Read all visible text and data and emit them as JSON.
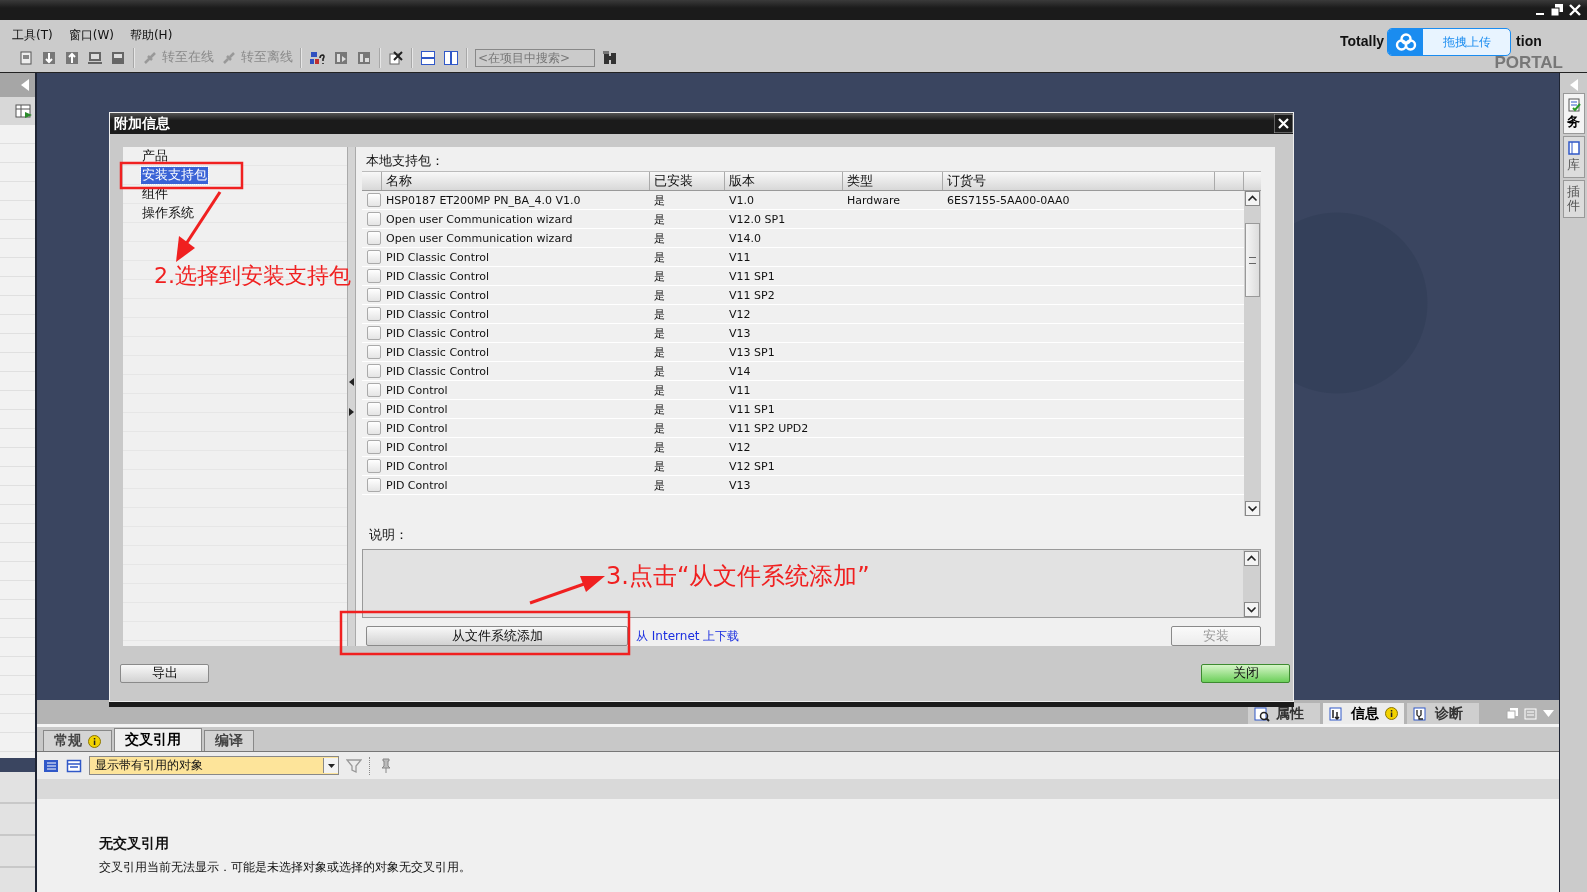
{
  "menu": [
    {
      "label": "工具(T)"
    },
    {
      "label": "窗口(W)"
    },
    {
      "label": "帮助(H)"
    }
  ],
  "toolbar": {
    "go_online": "转至在线",
    "go_offline": "转至离线",
    "search": {
      "placeholder": "<在项目中搜索>"
    }
  },
  "brand": {
    "line1_start": "Totally",
    "line1_end": "tion",
    "line2": "PORTAL"
  },
  "upload_widget": {
    "label": "拖拽上传"
  },
  "right_tabs": [
    {
      "label": "务",
      "selected": true
    },
    {
      "label": "库",
      "selected": false
    },
    {
      "label": "插件",
      "selected": false
    }
  ],
  "dialog": {
    "title": "附加信息",
    "nav": [
      {
        "label": "产品",
        "selected": false
      },
      {
        "label": "安装支持包",
        "selected": true
      },
      {
        "label": "组件",
        "selected": false
      },
      {
        "label": "操作系统",
        "selected": false
      }
    ],
    "section_label": "本地支持包：",
    "table": {
      "columns": [
        "名称",
        "已安装",
        "版本",
        "类型",
        "订货号"
      ],
      "rows": [
        {
          "checked": false,
          "cells": [
            "HSP0187 ET200MP PN_BA_4.0 V1.0",
            "是",
            "V1.0",
            "Hardware",
            "6ES7155-5AA00-0AA0"
          ]
        },
        {
          "checked": false,
          "cells": [
            "Open user Communication wizard",
            "是",
            "V12.0 SP1",
            "",
            ""
          ]
        },
        {
          "checked": false,
          "cells": [
            "Open user Communication wizard",
            "是",
            "V14.0",
            "",
            ""
          ]
        },
        {
          "checked": false,
          "cells": [
            "PID Classic Control",
            "是",
            "V11",
            "",
            ""
          ]
        },
        {
          "checked": false,
          "cells": [
            "PID Classic Control",
            "是",
            "V11 SP1",
            "",
            ""
          ]
        },
        {
          "checked": false,
          "cells": [
            "PID Classic Control",
            "是",
            "V11 SP2",
            "",
            ""
          ]
        },
        {
          "checked": false,
          "cells": [
            "PID Classic Control",
            "是",
            "V12",
            "",
            ""
          ]
        },
        {
          "checked": false,
          "cells": [
            "PID Classic Control",
            "是",
            "V13",
            "",
            ""
          ]
        },
        {
          "checked": false,
          "cells": [
            "PID Classic Control",
            "是",
            "V13 SP1",
            "",
            ""
          ]
        },
        {
          "checked": false,
          "cells": [
            "PID Classic Control",
            "是",
            "V14",
            "",
            ""
          ]
        },
        {
          "checked": false,
          "cells": [
            "PID Control",
            "是",
            "V11",
            "",
            ""
          ]
        },
        {
          "checked": false,
          "cells": [
            "PID Control",
            "是",
            "V11 SP1",
            "",
            ""
          ]
        },
        {
          "checked": false,
          "cells": [
            "PID Control",
            "是",
            "V11 SP2 UPD2",
            "",
            ""
          ]
        },
        {
          "checked": false,
          "cells": [
            "PID Control",
            "是",
            "V12",
            "",
            ""
          ]
        },
        {
          "checked": false,
          "cells": [
            "PID Control",
            "是",
            "V12 SP1",
            "",
            ""
          ]
        },
        {
          "checked": false,
          "cells": [
            "PID Control",
            "是",
            "V13",
            "",
            ""
          ]
        }
      ]
    },
    "description_label": "说明：",
    "add_button": "从文件系统添加",
    "download_link": "从 Internet 上下载",
    "install_button": {
      "label": "安装",
      "disabled": true
    },
    "export_button": "导出",
    "close_button": "关闭"
  },
  "annotations": [
    {
      "text": "2.选择到安装支持包"
    },
    {
      "text": "3.点击“从文件系统添加”"
    }
  ],
  "inspector": {
    "top_tabs": [
      {
        "label": "属性",
        "selected": false,
        "info": false
      },
      {
        "label": "信息",
        "selected": true,
        "info": true
      },
      {
        "label": "诊断",
        "selected": false,
        "info": false
      }
    ],
    "tabs": [
      {
        "label": "常规",
        "selected": false,
        "info": true
      },
      {
        "label": "交叉引用",
        "selected": true,
        "info": false
      },
      {
        "label": "编译",
        "selected": false,
        "info": false
      }
    ],
    "filter": {
      "value": "显示带有引用的对象"
    },
    "message": {
      "title": "无交叉引用",
      "text": "交叉引用当前无法显示．可能是未选择对象或选择的对象无交叉引用。"
    }
  }
}
